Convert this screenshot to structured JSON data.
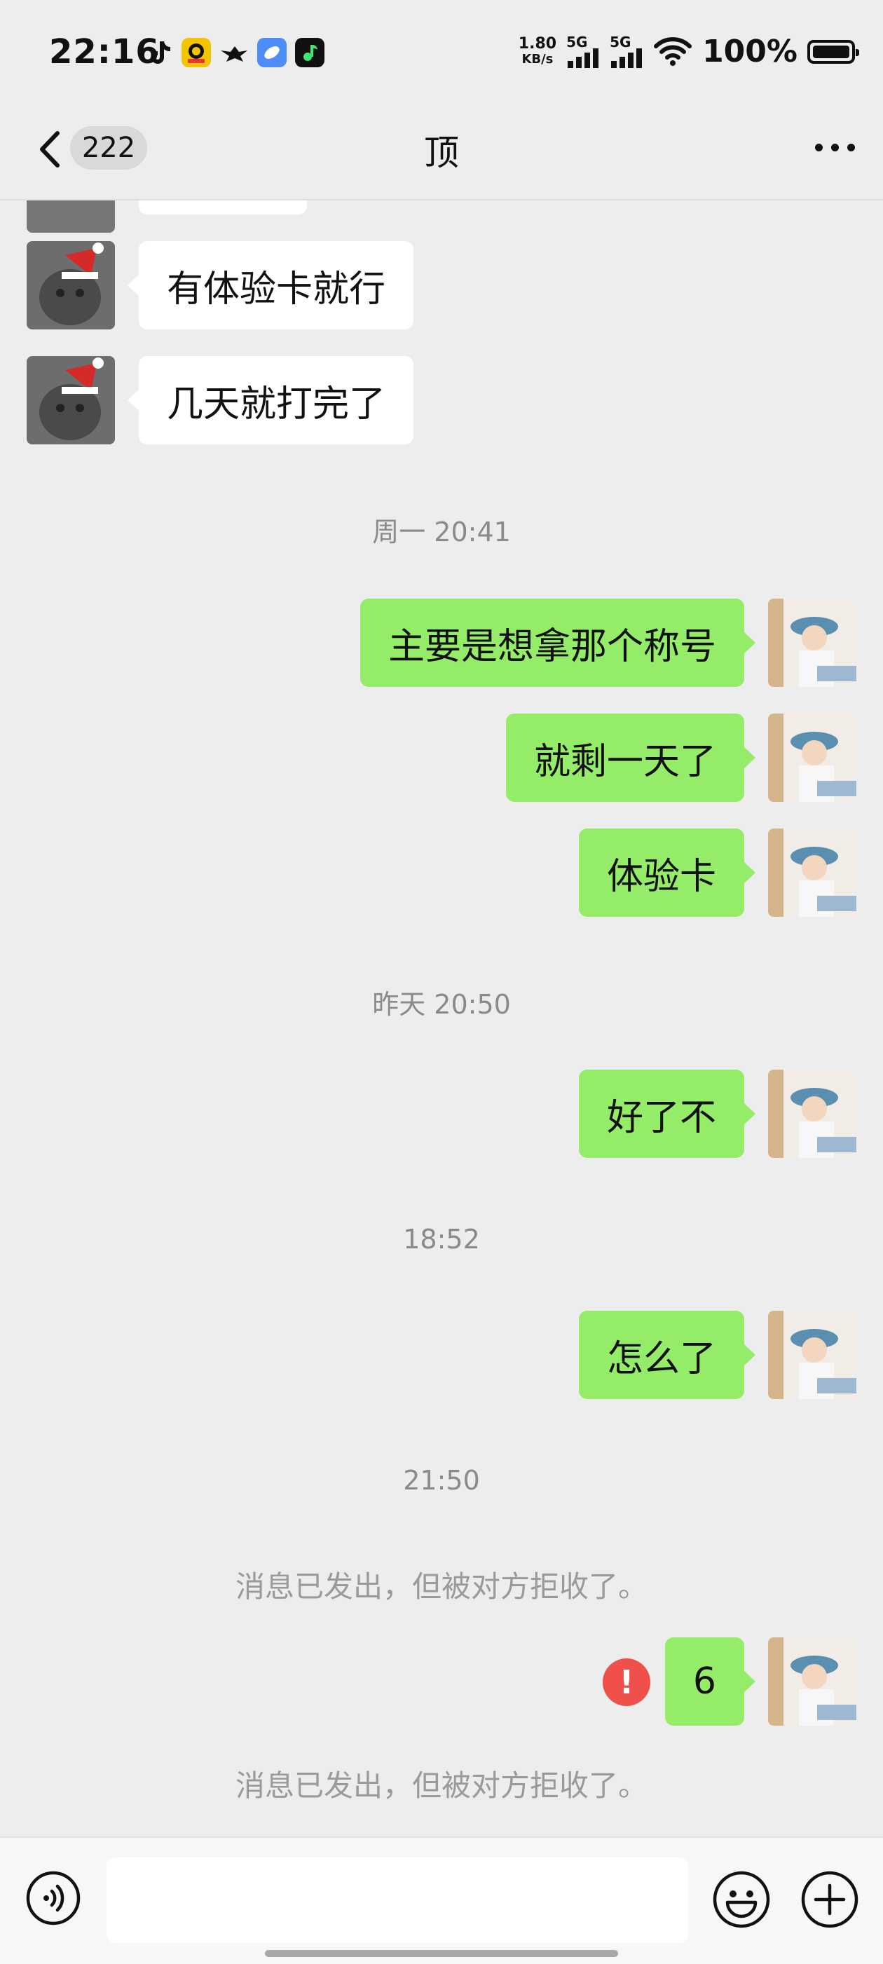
{
  "status_bar": {
    "time": "22:16",
    "net_speed_value": "1.80",
    "net_speed_unit": "KB/s",
    "signal1_label": "5G",
    "signal2_label": "5G",
    "battery_percent": "100%",
    "app_icons": [
      "tiktok-icon",
      "ydi-app-icon",
      "bird-app-icon",
      "blue-app-icon",
      "music-app-icon"
    ]
  },
  "header": {
    "back_badge": "222",
    "title": "顶"
  },
  "messages": {
    "m1": "有体验卡就行",
    "m2": "几天就打完了",
    "ts1": "周一 20:41",
    "m3": "主要是想拿那个称号",
    "m4": "就剩一天了",
    "m5": "体验卡",
    "ts2": "昨天 20:50",
    "m6": "好了不",
    "ts3": "18:52",
    "m7": "怎么了",
    "ts4": "21:50",
    "sys1": "消息已发出，但被对方拒收了。",
    "fail_mark": "!",
    "m8": "6",
    "sys2": "消息已发出，但被对方拒收了。"
  },
  "colors": {
    "background": "#ededed",
    "outgoing_bubble": "#95ec69",
    "incoming_bubble": "#ffffff",
    "fail_badge": "#f0504b"
  }
}
